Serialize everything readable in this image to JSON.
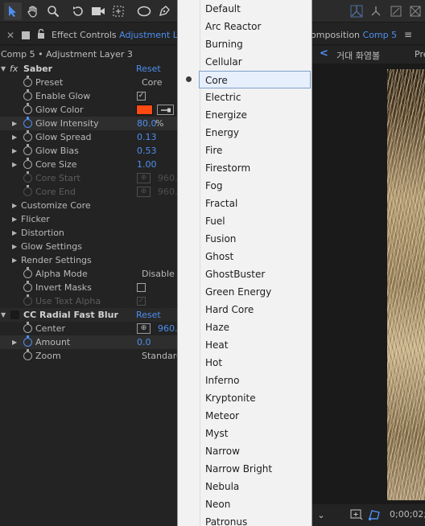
{
  "tabs": {
    "effect_controls_prefix": "Effect Controls",
    "effect_controls_layer": "Adjustment Lay",
    "composition_prefix": "omposition",
    "composition_name": "Comp 5"
  },
  "effect_controls": {
    "header": "Comp 5 • Adjustment Layer 3",
    "saber": {
      "fx": "fx",
      "name": "Saber",
      "reset": "Reset",
      "preset": {
        "label": "Preset",
        "value": "Core"
      },
      "enable_glow": {
        "label": "Enable Glow",
        "checked": "✓"
      },
      "glow_color": {
        "label": "Glow Color",
        "color": "#ff4a14"
      },
      "glow_intensity": {
        "label": "Glow Intensity",
        "value": "80.0",
        "unit": "%"
      },
      "glow_spread": {
        "label": "Glow Spread",
        "value": "0.13"
      },
      "glow_bias": {
        "label": "Glow Bias",
        "value": "0.53"
      },
      "core_size": {
        "label": "Core Size",
        "value": "1.00"
      },
      "core_start": {
        "label": "Core Start",
        "value": "960."
      },
      "core_end": {
        "label": "Core End",
        "value": "960."
      },
      "groups": [
        "Customize Core",
        "Flicker",
        "Distortion",
        "Glow Settings",
        "Render Settings"
      ],
      "alpha_mode": {
        "label": "Alpha Mode",
        "value": "Disable"
      },
      "invert_masks": {
        "label": "Invert Masks"
      },
      "use_text_alpha": {
        "label": "Use Text Alpha",
        "checked": "✓"
      }
    },
    "radial_blur": {
      "fx": "fx",
      "name": "CC Radial Fast Blur",
      "reset": "Reset",
      "center": {
        "label": "Center",
        "value": "960."
      },
      "amount": {
        "label": "Amount",
        "value": "0.0"
      },
      "zoom": {
        "label": "Zoom",
        "value": "Standard"
      }
    }
  },
  "preset_menu": {
    "items": [
      "Default",
      "Arc Reactor",
      "Burning",
      "Cellular",
      "Core",
      "Electric",
      "Energize",
      "Energy",
      "Fire",
      "Firestorm",
      "Fog",
      "Fractal",
      "Fuel",
      "Fusion",
      "Ghost",
      "GhostBuster",
      "Green Energy",
      "Hard Core",
      "Haze",
      "Heat",
      "Hot",
      "Inferno",
      "Kryptonite",
      "Meteor",
      "Myst",
      "Narrow",
      "Narrow Bright",
      "Nebula",
      "Neon",
      "Patronus"
    ],
    "selected": "Core"
  },
  "viewer": {
    "nav_label": "거대 화염볼",
    "nav_label2": "Pre",
    "timecode": "0;00;02;"
  }
}
